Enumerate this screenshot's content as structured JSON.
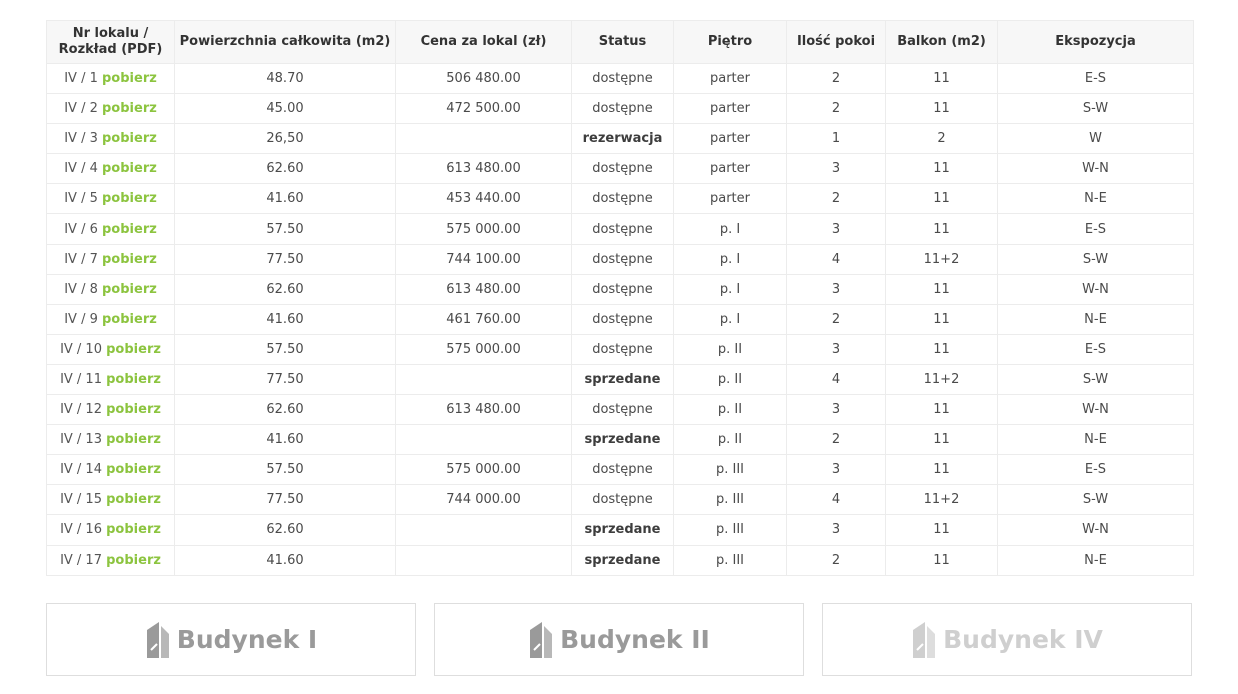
{
  "table": {
    "headers": [
      "Nr lokalu / Rozkład (PDF)",
      "Powierzchnia całkowita (m2)",
      "Cena za lokal (zł)",
      "Status",
      "Piętro",
      "Ilość pokoi",
      "Balkon (m2)",
      "Ekspozycja"
    ],
    "header_line1": "Nr lokalu /",
    "header_line2": "Rozkład (PDF)",
    "rows": [
      {
        "lokal": "IV / 1",
        "link": "pobierz",
        "area": "48.70",
        "price": "506 480.00",
        "status": "dostępne",
        "floor": "parter",
        "rooms": "2",
        "balcony": "11",
        "exposure": "E-S"
      },
      {
        "lokal": "IV / 2",
        "link": "pobierz",
        "area": "45.00",
        "price": "472 500.00",
        "status": "dostępne",
        "floor": "parter",
        "rooms": "2",
        "balcony": "11",
        "exposure": "S-W"
      },
      {
        "lokal": "IV / 3",
        "link": "pobierz",
        "area": "26,50",
        "price": "",
        "status": "rezerwacja",
        "floor": "parter",
        "rooms": "1",
        "balcony": "2",
        "exposure": "W"
      },
      {
        "lokal": "IV / 4",
        "link": "pobierz",
        "area": "62.60",
        "price": "613 480.00",
        "status": "dostępne",
        "floor": "parter",
        "rooms": "3",
        "balcony": "11",
        "exposure": "W-N"
      },
      {
        "lokal": "IV / 5",
        "link": "pobierz",
        "area": "41.60",
        "price": "453 440.00",
        "status": "dostępne",
        "floor": "parter",
        "rooms": "2",
        "balcony": "11",
        "exposure": "N-E"
      },
      {
        "lokal": "IV / 6",
        "link": "pobierz",
        "area": "57.50",
        "price": "575 000.00",
        "status": "dostępne",
        "floor": "p. I",
        "rooms": "3",
        "balcony": "11",
        "exposure": "E-S"
      },
      {
        "lokal": "IV / 7",
        "link": "pobierz",
        "area": "77.50",
        "price": "744 100.00",
        "status": "dostępne",
        "floor": "p. I",
        "rooms": "4",
        "balcony": "11+2",
        "exposure": "S-W"
      },
      {
        "lokal": "IV / 8",
        "link": "pobierz",
        "area": "62.60",
        "price": "613 480.00",
        "status": "dostępne",
        "floor": "p. I",
        "rooms": "3",
        "balcony": "11",
        "exposure": "W-N"
      },
      {
        "lokal": "IV / 9",
        "link": "pobierz",
        "area": "41.60",
        "price": "461 760.00",
        "status": "dostępne",
        "floor": "p. I",
        "rooms": "2",
        "balcony": "11",
        "exposure": "N-E"
      },
      {
        "lokal": "IV / 10",
        "link": "pobierz",
        "area": "57.50",
        "price": "575 000.00",
        "status": "dostępne",
        "floor": "p. II",
        "rooms": "3",
        "balcony": "11",
        "exposure": "E-S"
      },
      {
        "lokal": "IV / 11",
        "link": "pobierz",
        "area": "77.50",
        "price": "",
        "status": "sprzedane",
        "floor": "p. II",
        "rooms": "4",
        "balcony": "11+2",
        "exposure": "S-W"
      },
      {
        "lokal": "IV / 12",
        "link": "pobierz",
        "area": "62.60",
        "price": "613 480.00",
        "status": "dostępne",
        "floor": "p. II",
        "rooms": "3",
        "balcony": "11",
        "exposure": "W-N"
      },
      {
        "lokal": "IV / 13",
        "link": "pobierz",
        "area": "41.60",
        "price": "",
        "status": "sprzedane",
        "floor": "p. II",
        "rooms": "2",
        "balcony": "11",
        "exposure": "N-E"
      },
      {
        "lokal": "IV / 14",
        "link": "pobierz",
        "area": "57.50",
        "price": "575 000.00",
        "status": "dostępne",
        "floor": "p. III",
        "rooms": "3",
        "balcony": "11",
        "exposure": "E-S"
      },
      {
        "lokal": "IV / 15",
        "link": "pobierz",
        "area": "77.50",
        "price": "744 000.00",
        "status": "dostępne",
        "floor": "p. III",
        "rooms": "4",
        "balcony": "11+2",
        "exposure": "S-W"
      },
      {
        "lokal": "IV / 16",
        "link": "pobierz",
        "area": "62.60",
        "price": "",
        "status": "sprzedane",
        "floor": "p. III",
        "rooms": "3",
        "balcony": "11",
        "exposure": "W-N"
      },
      {
        "lokal": "IV / 17",
        "link": "pobierz",
        "area": "41.60",
        "price": "",
        "status": "sprzedane",
        "floor": "p. III",
        "rooms": "2",
        "balcony": "11",
        "exposure": "N-E"
      }
    ]
  },
  "buildings": [
    {
      "label": "Budynek I",
      "icon": "building-icon",
      "active": true
    },
    {
      "label": "Budynek II",
      "icon": "building-icon",
      "active": true
    },
    {
      "label": "Budynek IV",
      "icon": "building-icon",
      "active": false
    }
  ],
  "colors": {
    "link_green": "#8cc43f",
    "text": "#4a4a4a",
    "border": "#ececec",
    "header_bg": "#f7f7f7"
  }
}
